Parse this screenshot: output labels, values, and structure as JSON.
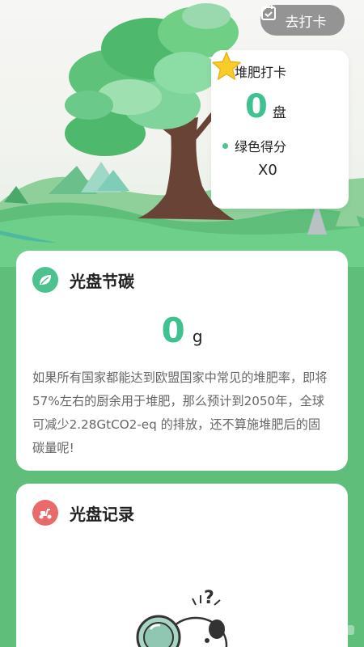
{
  "header": {
    "checkin_button_label": "去打卡",
    "checkin_icon": "calendar-check-icon"
  },
  "stats": {
    "compost_label": "堆肥打卡",
    "compost_value": "0",
    "compost_unit": "盘",
    "green_score_label": "绿色得分",
    "green_score_icon": "star-icon",
    "green_score_value": "X0"
  },
  "carbon_card": {
    "title": "光盘节碳",
    "icon": "carbon-leaf-icon",
    "value": "0",
    "unit": "g",
    "description": "如果所有国家都能达到欧盟国家中常见的堆肥率，即将57%左右的厨余用于堆肥，那么预计到2050年，全球可减少2.28GtCO2-eq 的排放，还不算施堆肥后的固碳量呢!"
  },
  "record_card": {
    "title": "光盘记录",
    "icon": "scooter-icon"
  },
  "colors": {
    "accent": "#3fc28f",
    "background": "#5fbf7a",
    "record_icon": "#e86a6a"
  }
}
